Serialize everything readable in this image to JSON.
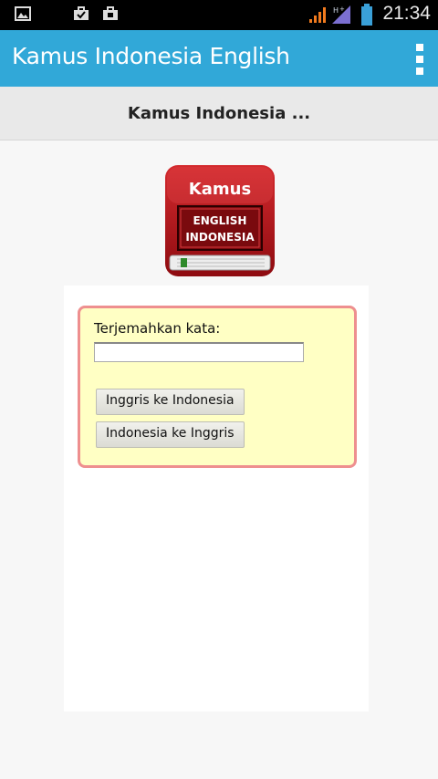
{
  "status_bar": {
    "time": "21:34",
    "icons": [
      "picture-icon",
      "briefcase-notification-icon",
      "briefcase-notification-icon",
      "signal-icon",
      "data-network-icon",
      "battery-icon"
    ]
  },
  "action_bar": {
    "title": "Kamus Indonesia English",
    "menu_icon": "overflow-menu-icon"
  },
  "page": {
    "title": "Kamus Indonesia ..."
  },
  "logo": {
    "line1": "Kamus",
    "line2": "ENGLISH",
    "line3": "INDONESIA"
  },
  "form": {
    "label": "Terjemahkan kata:",
    "input_value": "",
    "button_en_id": "Inggris ke Indonesia",
    "button_id_en": "Indonesia ke Inggris"
  },
  "colors": {
    "action_bar": "#31a8d8",
    "form_background": "#ffffc4",
    "form_border": "#ee8f8f",
    "logo_red": "#b8141b"
  }
}
